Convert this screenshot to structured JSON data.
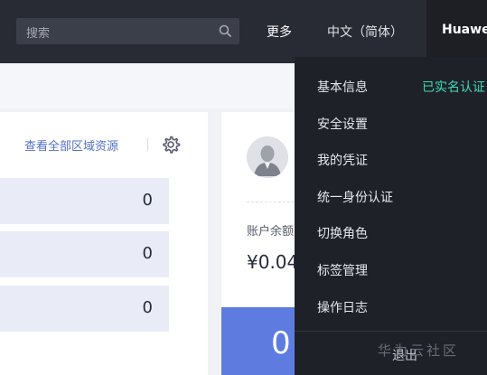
{
  "header": {
    "search_placeholder": "搜索",
    "more_label": "更多",
    "language_label": "中文（简体）",
    "user_label": "Huawei"
  },
  "resources": {
    "view_all_link": "查看全部区域资源",
    "rows": [
      {
        "count": "0"
      },
      {
        "count": "0"
      },
      {
        "count": "0"
      }
    ]
  },
  "account": {
    "balance_label": "账户余额",
    "balance_value": "¥0.04",
    "big_count": "0"
  },
  "user_menu": {
    "items": [
      "基本信息",
      "安全设置",
      "我的凭证",
      "统一身份认证",
      "切换角色",
      "标签管理",
      "操作日志"
    ],
    "verified_status": "已实名认证",
    "logout_label": "退出"
  },
  "watermark": "华为云社区",
  "colors": {
    "topbar": "#282b33",
    "dropdown_bg": "#1f2129",
    "link_blue": "#526ecc",
    "verified_green": "#3ddbb5",
    "accent_blue": "#5e7ce0",
    "row_bg": "#e9ecf7"
  }
}
